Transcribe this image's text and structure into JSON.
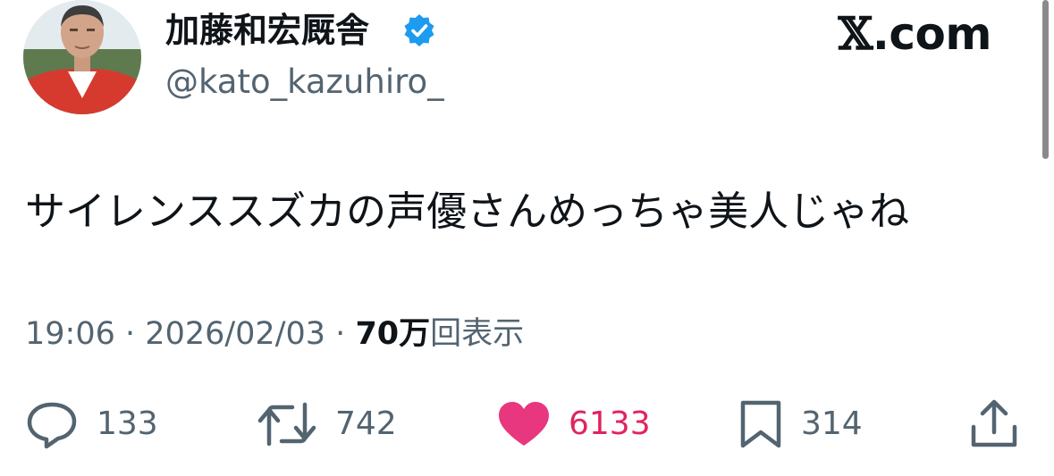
{
  "author": {
    "display_name": "加藤和宏厩舎",
    "handle": "@kato_kazuhiro_",
    "verified": true,
    "verified_color": "#1d9bf0"
  },
  "brand": {
    "x_glyph": "𝕏",
    "domain": ".com"
  },
  "tweet": {
    "text": "サイレンススズカの声優さんめっちゃ美人じゃね",
    "time": "19:06",
    "separator": "·",
    "date": "2026/02/03",
    "views_count": "70万",
    "views_label": "回表示"
  },
  "actions": {
    "reply": {
      "icon": "reply-icon",
      "count": "133"
    },
    "retweet": {
      "icon": "retweet-icon",
      "count": "742"
    },
    "like": {
      "icon": "heart-icon",
      "count": "6133",
      "active": true,
      "color": "#e8377f"
    },
    "bookmark": {
      "icon": "bookmark-icon",
      "count": "314"
    },
    "share": {
      "icon": "share-icon"
    }
  }
}
